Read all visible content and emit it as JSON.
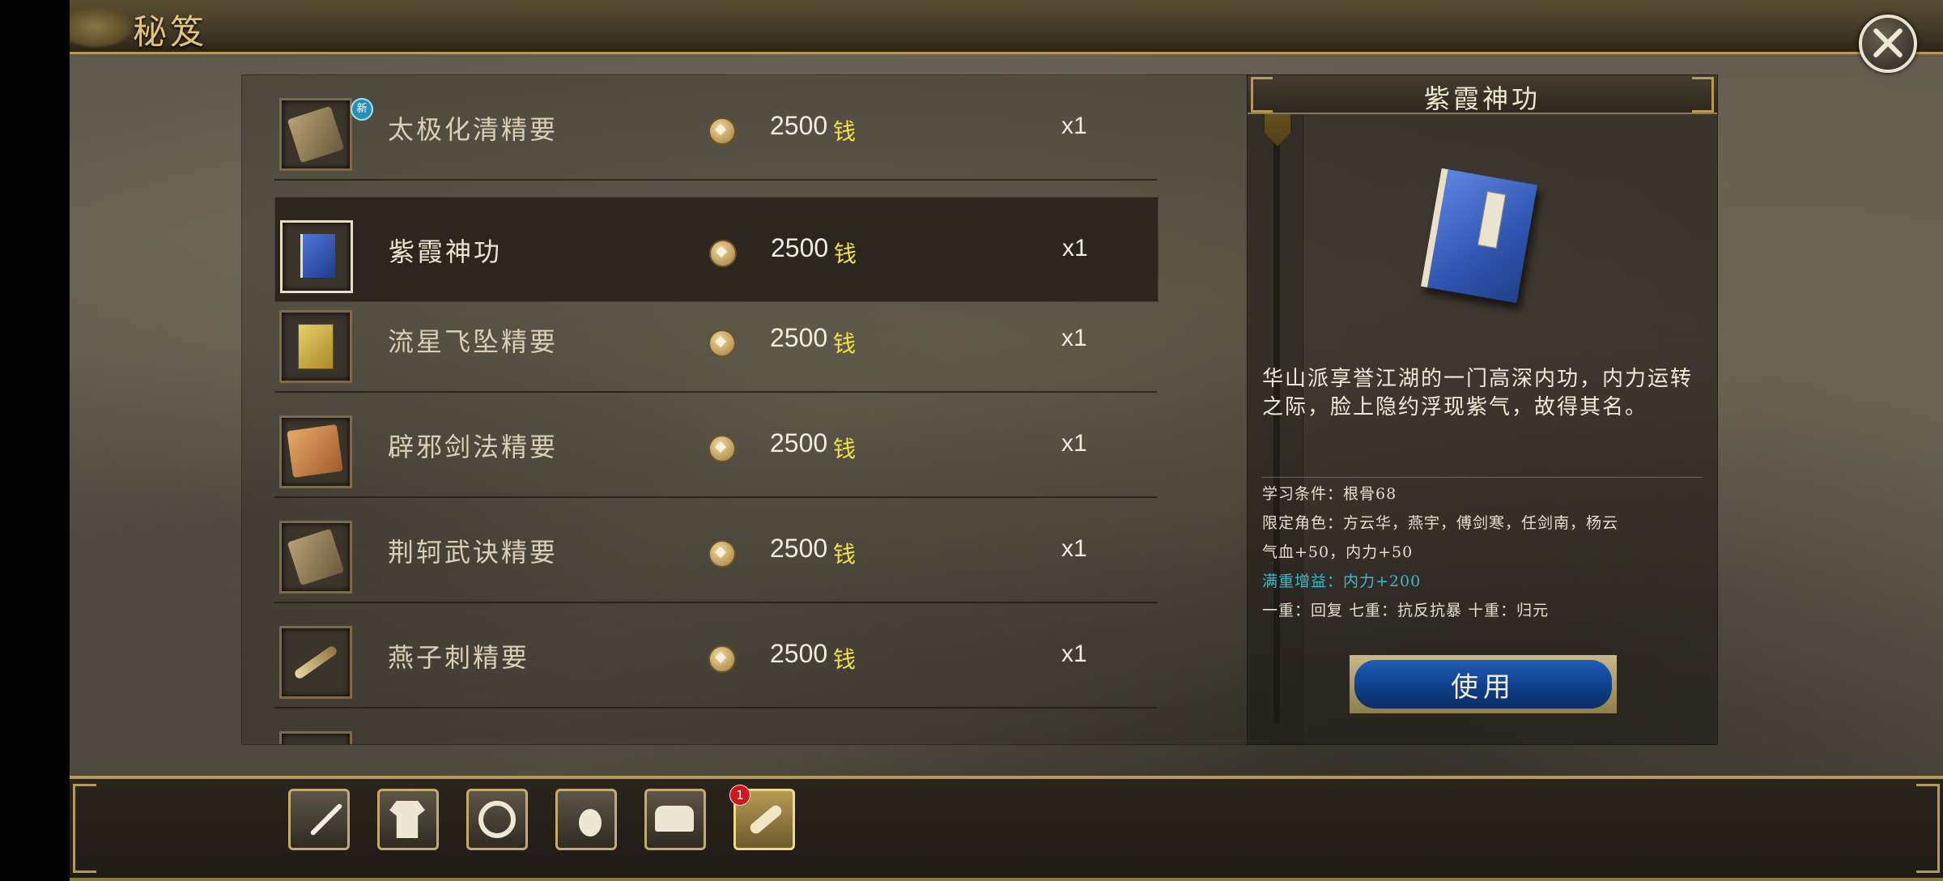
{
  "header": {
    "title": "秘笈"
  },
  "list": {
    "items": [
      {
        "name": "太极化清精要",
        "price": "2500",
        "currency": "钱",
        "qty": "x1",
        "badge": "新",
        "icon": "scroll-book-icon"
      },
      {
        "name": "紫霞神功",
        "price": "2500",
        "currency": "钱",
        "qty": "x1",
        "icon": "blue-book-icon"
      },
      {
        "name": "流星飞坠精要",
        "price": "2500",
        "currency": "钱",
        "qty": "x1",
        "icon": "yellow-book-icon"
      },
      {
        "name": "辟邪剑法精要",
        "price": "2500",
        "currency": "钱",
        "qty": "x1",
        "icon": "parchment-icon"
      },
      {
        "name": "荆轲武诀精要",
        "price": "2500",
        "currency": "钱",
        "qty": "x1",
        "icon": "scroll-book-icon"
      },
      {
        "name": "燕子刺精要",
        "price": "2500",
        "currency": "钱",
        "qty": "x1",
        "icon": "brush-scroll-icon"
      }
    ],
    "selected_index": 1
  },
  "detail": {
    "title": "紫霞神功",
    "description": "华山派享誉江湖的一门高深内功，内力运转之际，脸上隐约浮现紫气，故得其名。",
    "requirement": "学习条件：根骨68",
    "roles_line1": "限定角色：方云华，燕宇，傅剑寒，任剑南，杨云",
    "stats": "气血+50，内力+50",
    "bonus": "满重增益：内力+200",
    "levels": "一重：回复 七重：抗反抗暴 十重：归元",
    "use_label": "使用"
  },
  "toolbar": {
    "tools": [
      {
        "icon": "sword-icon"
      },
      {
        "icon": "armor-icon"
      },
      {
        "icon": "ring-icon"
      },
      {
        "icon": "gourd-icon"
      },
      {
        "icon": "chest-icon"
      },
      {
        "icon": "scroll-icon",
        "notification": "1"
      }
    ],
    "active_index": 5
  },
  "colors": {
    "currency": "#f2e24a",
    "bonus_text": "#3fb8c9",
    "gold_trim": "#b59a55",
    "use_button": "#0f3f8a"
  }
}
